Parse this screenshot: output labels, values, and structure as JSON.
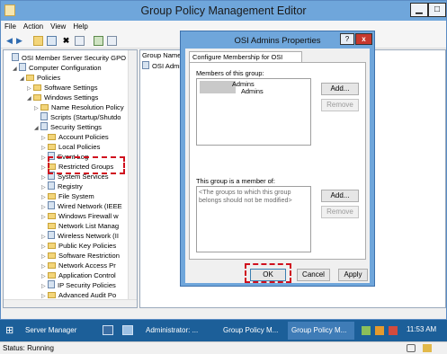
{
  "window": {
    "title": "Group Policy Management Editor"
  },
  "menu": [
    "File",
    "Action",
    "View",
    "Help"
  ],
  "tree": {
    "items": [
      {
        "label": "OSI Member Server Security GPO [ADI",
        "indent": 0
      },
      {
        "label": "Computer Configuration",
        "indent": 1
      },
      {
        "label": "Policies",
        "indent": 2
      },
      {
        "label": "Software Settings",
        "indent": 3
      },
      {
        "label": "Windows Settings",
        "indent": 3
      },
      {
        "label": "Name Resolution Policy",
        "indent": 4
      },
      {
        "label": "Scripts (Startup/Shutdo",
        "indent": 4
      },
      {
        "label": "Security Settings",
        "indent": 4
      },
      {
        "label": "Account Policies",
        "indent": 5
      },
      {
        "label": "Local Policies",
        "indent": 5
      },
      {
        "label": "Event Log",
        "indent": 5
      },
      {
        "label": "Restricted Groups",
        "indent": 5
      },
      {
        "label": "System Services",
        "indent": 5
      },
      {
        "label": "Registry",
        "indent": 5
      },
      {
        "label": "File System",
        "indent": 5
      },
      {
        "label": "Wired Network (IEEE",
        "indent": 5
      },
      {
        "label": "Windows Firewall w",
        "indent": 5
      },
      {
        "label": "Network List Manag",
        "indent": 5
      },
      {
        "label": "Wireless Network (II",
        "indent": 5
      },
      {
        "label": "Public Key Policies",
        "indent": 5
      },
      {
        "label": "Software Restriction",
        "indent": 5
      },
      {
        "label": "Network Access Pr",
        "indent": 5
      },
      {
        "label": "Application Control",
        "indent": 5
      },
      {
        "label": "IP Security Policies",
        "indent": 5
      },
      {
        "label": "Advanced Audit Po",
        "indent": 5
      }
    ]
  },
  "right_pane": {
    "column_header": "Group Name",
    "row": "OSI Admi"
  },
  "dialog": {
    "title": "OSI Admins Properties",
    "help": "?",
    "close": "x",
    "tab": "Configure Membership for OSI Admins",
    "members_label": "Members of this group:",
    "members": [
      "Admins",
      "Admins"
    ],
    "add": "Add...",
    "remove": "Remove",
    "memberof_label": "This group is a member of:",
    "memberof_text": "<The groups to which this group belongs should not be modified>",
    "ok": "OK",
    "cancel": "Cancel",
    "apply": "Apply"
  },
  "taskbar": {
    "items": [
      "Server Manager",
      "Administrator: ...",
      "Group Policy M...",
      "Group Policy M..."
    ],
    "time": "11:53 AM"
  },
  "status": "Status: Running"
}
